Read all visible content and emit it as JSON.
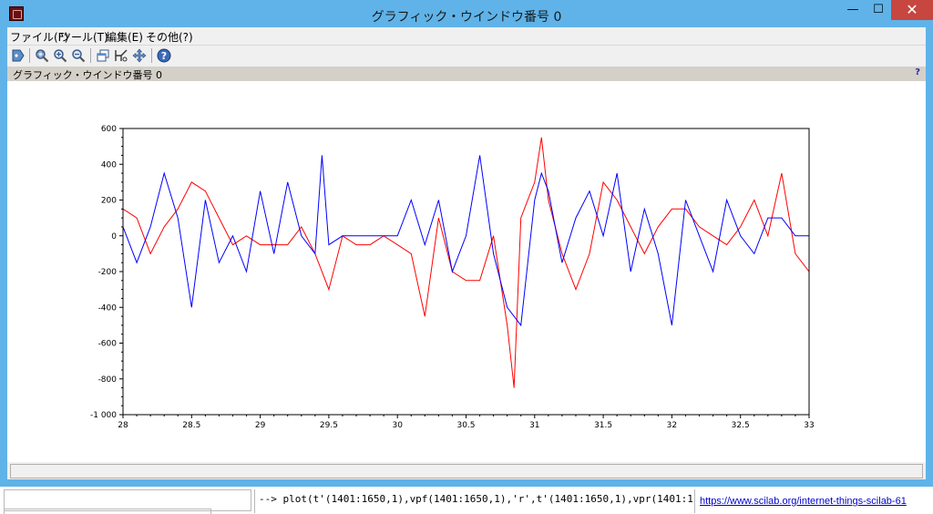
{
  "window": {
    "title": "グラフィック・ウインドウ番号 0",
    "minimize_glyph": "—",
    "maximize_glyph": "☐",
    "close_glyph": "✕"
  },
  "menu": {
    "items": [
      "ファイル(F)",
      "ツール(T)",
      "編集(E)",
      "その他(?)"
    ]
  },
  "toolbar": {
    "icons": [
      "data-tips-icon",
      "zoom-icon",
      "zoom-in-icon",
      "zoom-out-icon",
      "copy-window-icon",
      "datatip-icon",
      "pan-icon",
      "help-icon"
    ]
  },
  "infobar": {
    "label": "グラフィック・ウインドウ番号 0",
    "help": "?"
  },
  "console": {
    "command": "--> plot(t'(1401:1650,1),vpf(1401:1650,1),'r',t'(1401:1650,1),vpr(1401:1650,1),'b')",
    "link": "https://www.scilab.org/internet-things-scilab-61"
  },
  "colors": {
    "titlebar": "#5fb3e8",
    "series_red": "#ff0000",
    "series_blue": "#0000ff"
  },
  "chart_data": {
    "type": "line",
    "title": "",
    "xlabel": "",
    "ylabel": "",
    "xlim": [
      28,
      33
    ],
    "ylim": [
      -1000,
      600
    ],
    "xticks": [
      "28",
      "28.5",
      "29",
      "29.5",
      "30",
      "30.5",
      "31",
      "31.5",
      "32",
      "32.5",
      "33"
    ],
    "yticks": [
      "600",
      "400",
      "200",
      "0",
      "-200",
      "-400",
      "-600",
      "-800",
      "-1 000"
    ],
    "grid": false,
    "series": [
      {
        "color": "#ff0000",
        "x": [
          28.0,
          28.1,
          28.2,
          28.3,
          28.4,
          28.5,
          28.6,
          28.7,
          28.8,
          28.9,
          29.0,
          29.1,
          29.2,
          29.3,
          29.4,
          29.5,
          29.6,
          29.7,
          29.8,
          29.9,
          30.0,
          30.1,
          30.2,
          30.3,
          30.4,
          30.5,
          30.6,
          30.7,
          30.8,
          30.85,
          30.9,
          31.0,
          31.05,
          31.1,
          31.2,
          31.3,
          31.4,
          31.5,
          31.6,
          31.7,
          31.8,
          31.9,
          32.0,
          32.1,
          32.2,
          32.3,
          32.4,
          32.5,
          32.6,
          32.7,
          32.8,
          32.9,
          33.0
        ],
        "y": [
          150,
          100,
          -100,
          50,
          150,
          300,
          250,
          100,
          -50,
          0,
          -50,
          -50,
          -50,
          50,
          -100,
          -300,
          0,
          -50,
          -50,
          0,
          -50,
          -100,
          -450,
          100,
          -200,
          -250,
          -250,
          0,
          -500,
          -850,
          100,
          300,
          550,
          200,
          -100,
          -300,
          -100,
          300,
          200,
          50,
          -100,
          50,
          150,
          150,
          50,
          0,
          -50,
          50,
          200,
          0,
          350,
          -100,
          -200
        ]
      },
      {
        "color": "#0000ff",
        "x": [
          28.0,
          28.1,
          28.2,
          28.3,
          28.4,
          28.5,
          28.6,
          28.7,
          28.8,
          28.9,
          29.0,
          29.1,
          29.2,
          29.3,
          29.4,
          29.45,
          29.5,
          29.6,
          29.7,
          29.8,
          29.9,
          30.0,
          30.1,
          30.2,
          30.3,
          30.4,
          30.5,
          30.6,
          30.7,
          30.8,
          30.9,
          31.0,
          31.05,
          31.1,
          31.2,
          31.3,
          31.4,
          31.5,
          31.6,
          31.7,
          31.8,
          31.9,
          32.0,
          32.1,
          32.2,
          32.3,
          32.4,
          32.5,
          32.6,
          32.7,
          32.8,
          32.9,
          33.0
        ],
        "y": [
          50,
          -150,
          50,
          350,
          100,
          -400,
          200,
          -150,
          0,
          -200,
          250,
          -100,
          300,
          0,
          -100,
          450,
          -50,
          0,
          0,
          0,
          0,
          0,
          200,
          -50,
          200,
          -200,
          0,
          450,
          -100,
          -400,
          -500,
          200,
          350,
          250,
          -150,
          100,
          250,
          0,
          350,
          -200,
          150,
          -100,
          -500,
          200,
          0,
          -200,
          200,
          0,
          -100,
          100,
          100,
          0,
          0
        ]
      }
    ]
  }
}
